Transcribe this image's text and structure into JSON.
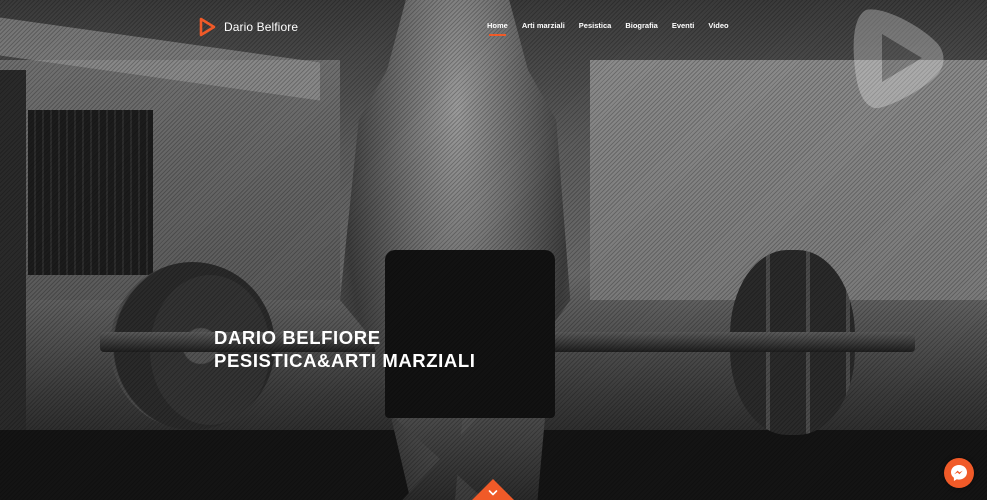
{
  "brand": {
    "name": "Dario Belfiore",
    "logo_icon": "play-triangle-icon"
  },
  "nav": {
    "items": [
      {
        "label": "Home",
        "active": true
      },
      {
        "label": "Arti marziali",
        "active": false
      },
      {
        "label": "Pesistica",
        "active": false
      },
      {
        "label": "Biografia",
        "active": false
      },
      {
        "label": "Eventi",
        "active": false
      },
      {
        "label": "Video",
        "active": false
      }
    ]
  },
  "hero": {
    "title_line1": "DARIO BELFIORE",
    "title_line2": "PESISTICA&ARTI MARZIALI"
  },
  "icons": {
    "messenger": "messenger-icon",
    "scroll": "chevron-down-icon",
    "watermark": "play-triangle-icon"
  },
  "colors": {
    "accent": "#f05a28",
    "text": "#ffffff"
  }
}
